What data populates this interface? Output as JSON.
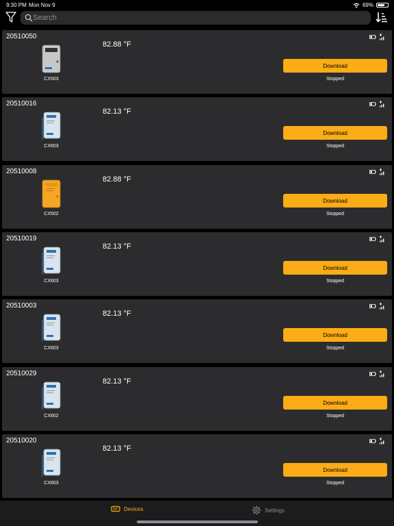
{
  "status_bar": {
    "time": "9:30 PM",
    "date": "Mon Nov 9",
    "battery": "69%",
    "battery_level": 0.69
  },
  "search": {
    "placeholder": "Search",
    "value": ""
  },
  "devices": [
    {
      "serial": "20510050",
      "temperature": "82.88 °F",
      "model": "CX503",
      "download_label": "Download",
      "state": "Stopped",
      "color": "#c8c8c8"
    },
    {
      "serial": "20510016",
      "temperature": "82.13 °F",
      "model": "CX603",
      "download_label": "Download",
      "state": "Stopped",
      "color": "#d9e4ee"
    },
    {
      "serial": "20510008",
      "temperature": "82.88 °F",
      "model": "CX502",
      "download_label": "Download",
      "state": "Stopped",
      "color": "#f5a623"
    },
    {
      "serial": "20510019",
      "temperature": "82.13 °F",
      "model": "CX603",
      "download_label": "Download",
      "state": "Stopped",
      "color": "#d9e4ee"
    },
    {
      "serial": "20510003",
      "temperature": "82.13 °F",
      "model": "CX603",
      "download_label": "Download",
      "state": "Stopped",
      "color": "#d9e4ee"
    },
    {
      "serial": "20510029",
      "temperature": "82.13 °F",
      "model": "CX602",
      "download_label": "Download",
      "state": "Stopped",
      "color": "#d9e4ee"
    },
    {
      "serial": "20510020",
      "temperature": "82.13 °F",
      "model": "CX603",
      "download_label": "Download",
      "state": "Stopped",
      "color": "#d9e4ee"
    }
  ],
  "tabbar": {
    "devices_label": "Devices",
    "settings_label": "Settings"
  },
  "colors": {
    "accent": "#fbac16",
    "card": "#2c2c2e",
    "background": "#000000"
  }
}
